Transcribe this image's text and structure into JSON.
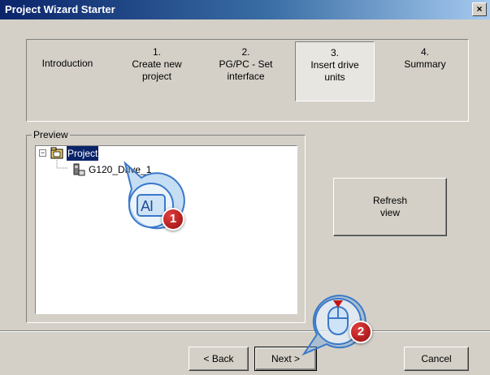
{
  "window": {
    "title": "Project Wizard Starter",
    "close_glyph": "×"
  },
  "steps": [
    {
      "number": "",
      "label": "Introduction"
    },
    {
      "number": "1.",
      "label": "Create new project"
    },
    {
      "number": "2.",
      "label": "PG/PC - Set interface"
    },
    {
      "number": "3.",
      "label": "Insert drive units"
    },
    {
      "number": "4.",
      "label": "Summary"
    }
  ],
  "preview": {
    "legend": "Preview",
    "tree": {
      "root": "Project",
      "child": "G120_Drive_1"
    }
  },
  "refresh_button": {
    "label": "Refresh view"
  },
  "buttons": {
    "back": "< Back",
    "next": "Next >",
    "cancel": "Cancel"
  },
  "callouts": [
    {
      "number": "1",
      "icon": "keyboard-input-icon",
      "text": "AI"
    },
    {
      "number": "2",
      "icon": "mouse-click-icon"
    }
  ],
  "colors": {
    "titlebar": "#0a246a",
    "selection": "#0a246a",
    "badge": "#c0171b",
    "callout": "#5aa0e0"
  }
}
